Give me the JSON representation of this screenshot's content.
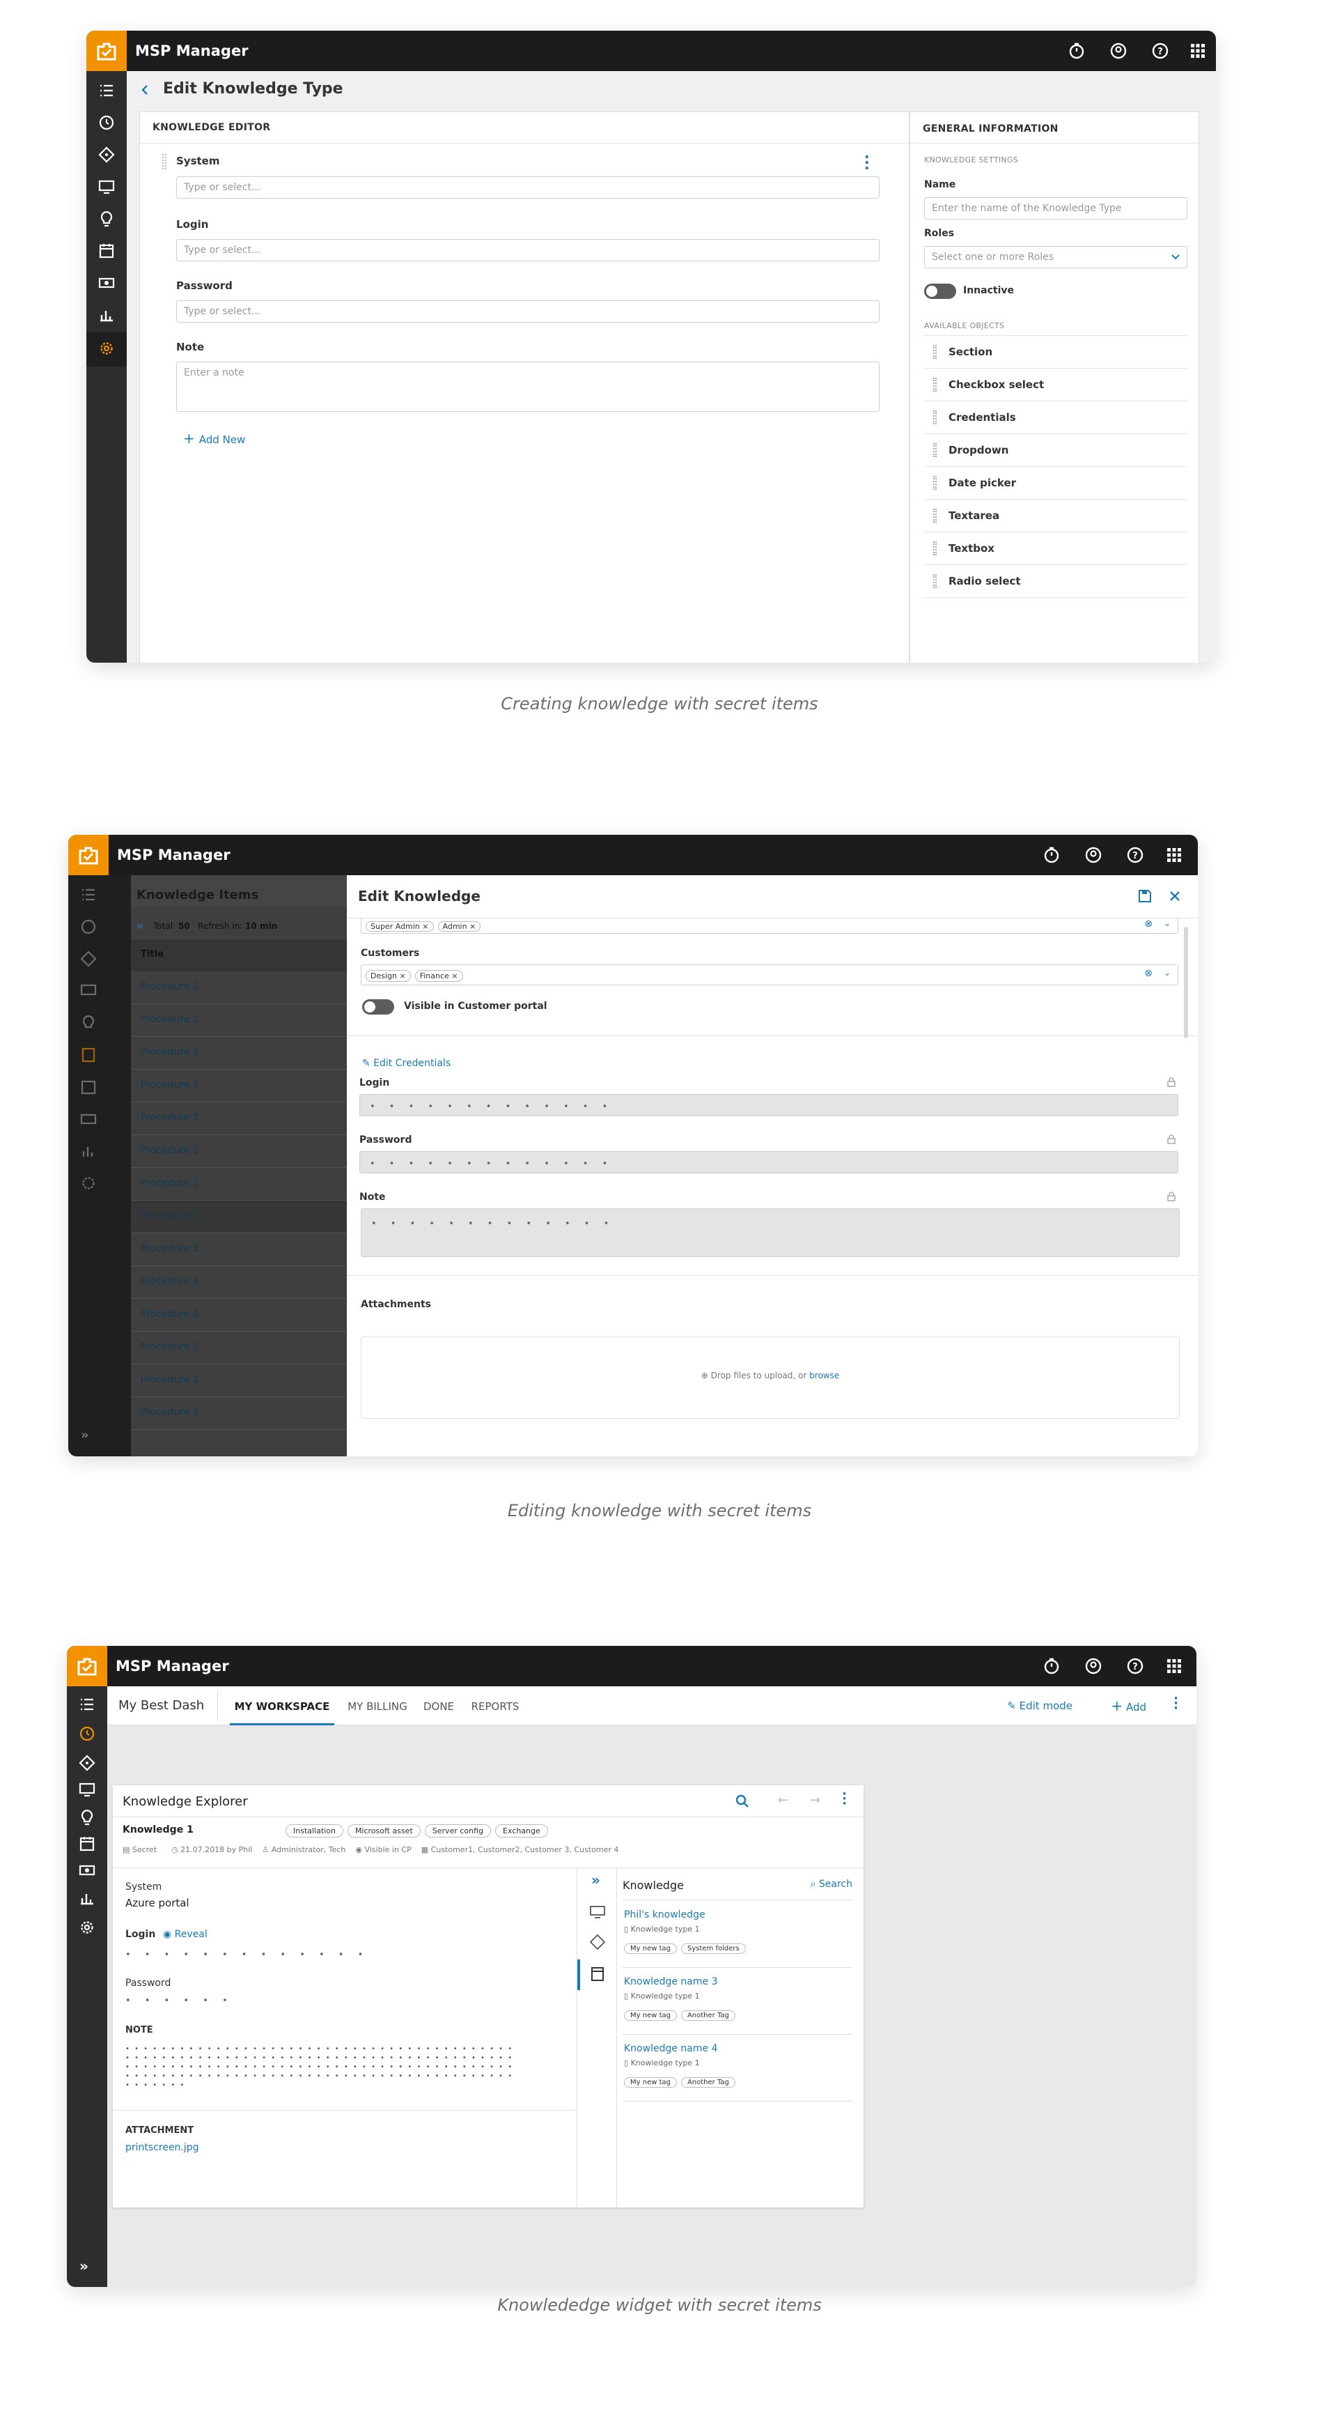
{
  "app_name": "MSP Manager",
  "colors": {
    "accent": "#f39200",
    "link": "#1a7ab5",
    "topbar": "#1c1c1c",
    "sidebar": "#2d2d2d"
  },
  "captions": [
    "Creating knowledge with secret items",
    "Editing knowledge with secret items",
    "Knowlededge widget with secret items"
  ],
  "shot1": {
    "page_title": "Edit Knowledge Type",
    "editor_header": "KNOWLEDGE EDITOR",
    "fields": [
      {
        "label": "System",
        "placeholder": "Type or select..."
      },
      {
        "label": "Login",
        "placeholder": "Type or select..."
      },
      {
        "label": "Password",
        "placeholder": "Type or select..."
      }
    ],
    "note_label": "Note",
    "note_placeholder": "Enter a note",
    "add_new": "Add New",
    "general_header": "GENERAL INFORMATION",
    "settings_header": "KNOWLEDGE SETTINGS",
    "name_label": "Name",
    "name_placeholder": "Enter the name of the Knowledge Type",
    "roles_label": "Roles",
    "roles_placeholder": "Select one or more Roles",
    "inactive_label": "Innactive",
    "objects_header": "AVAILABLE OBJECTS",
    "objects": [
      "Section",
      "Checkbox select",
      "Credentials",
      "Dropdown",
      "Date picker",
      "Textarea",
      "Textbox",
      "Radio select"
    ]
  },
  "shot2": {
    "list_title": "Knowledge Items",
    "total_label": "Total:",
    "total_value": "50",
    "refresh_label": "Refresh in:",
    "refresh_value": "10 min",
    "col_title": "Title",
    "procedures": [
      "Procedure 1",
      "Procedure 1",
      "Procedure 1",
      "Procedure 1",
      "Procedure 1",
      "Procedure 1",
      "Procedure 1",
      "Procedure 1",
      "Procedure 1",
      "Procedure 1",
      "Procedure 1",
      "Procedure 1",
      "Procedure 1",
      "Procedure 1"
    ],
    "panel_title": "Edit Knowledge",
    "roles_chips": [
      "Super Admin",
      "Admin"
    ],
    "customers_label": "Customers",
    "customers_chips": [
      "Design",
      "Finance"
    ],
    "visible_label": "Visible in Customer portal",
    "edit_credentials": "Edit Credentials",
    "login_label": "Login",
    "password_label": "Password",
    "note_label": "Note",
    "masked": "• • • • • • • • • • • • •",
    "attachments_label": "Attachments",
    "drop_text": "Drop files to upload, or",
    "browse": "browse"
  },
  "shot3": {
    "dash_name": "My Best Dash",
    "tabs": [
      "MY WORKSPACE",
      "MY BILLING",
      "DONE",
      "REPORTS"
    ],
    "edit_mode": "Edit mode",
    "add": "Add",
    "widget_title": "Knowledge Explorer",
    "item_title": "Knowledge 1",
    "tags": [
      "Installation",
      "Microsoft asset",
      "Server config",
      "Exchange"
    ],
    "meta": [
      "Secret",
      "21.07.2018 by Phil",
      "Administrator, Tech",
      "Visible in CP",
      "Customer1, Customer2, Customer 3, Customer 4"
    ],
    "system_label": "System",
    "system_value": "Azure portal",
    "login_label": "Login",
    "reveal": "Reveal",
    "login_masked": "• • • • • • • • • • • • •",
    "password_label": "Password",
    "password_masked": "• • • • • •",
    "note_label": "NOTE",
    "note_masked": [
      "• • • • • • • • • • • • • • • • • • • • • • • • • • • • • • • • • • • • • • • • • • •",
      "• • • • • • • • • • • • • • • • • • • • • • • • • • • • • • • • • • • • • • • • • • •",
      "• • • • • • • • • • • • • • • • • • • • • • • • • • • • • • • • • • • • • • • • • • •",
      "• • • • • • • • • • • • • • • • • • • • • • • • • • • • • • • • • • • • • • • • • • •",
      "• • • • • • •"
    ],
    "attachment_label": "ATTACHMENT",
    "attachment_file": "printscreen.jpg",
    "knowledge_header": "Knowledge",
    "search": "Search",
    "items": [
      {
        "title": "Phil's knowledge",
        "type": "Knowledge type 1",
        "tags": [
          "My new tag",
          "System folders"
        ]
      },
      {
        "title": "Knowledge name 3",
        "type": "Knowledge type 1",
        "tags": [
          "My new tag",
          "Another Tag"
        ]
      },
      {
        "title": "Knowledge name 4",
        "type": "Knowledge type 1",
        "tags": [
          "My new tag",
          "Another Tag"
        ]
      }
    ]
  }
}
